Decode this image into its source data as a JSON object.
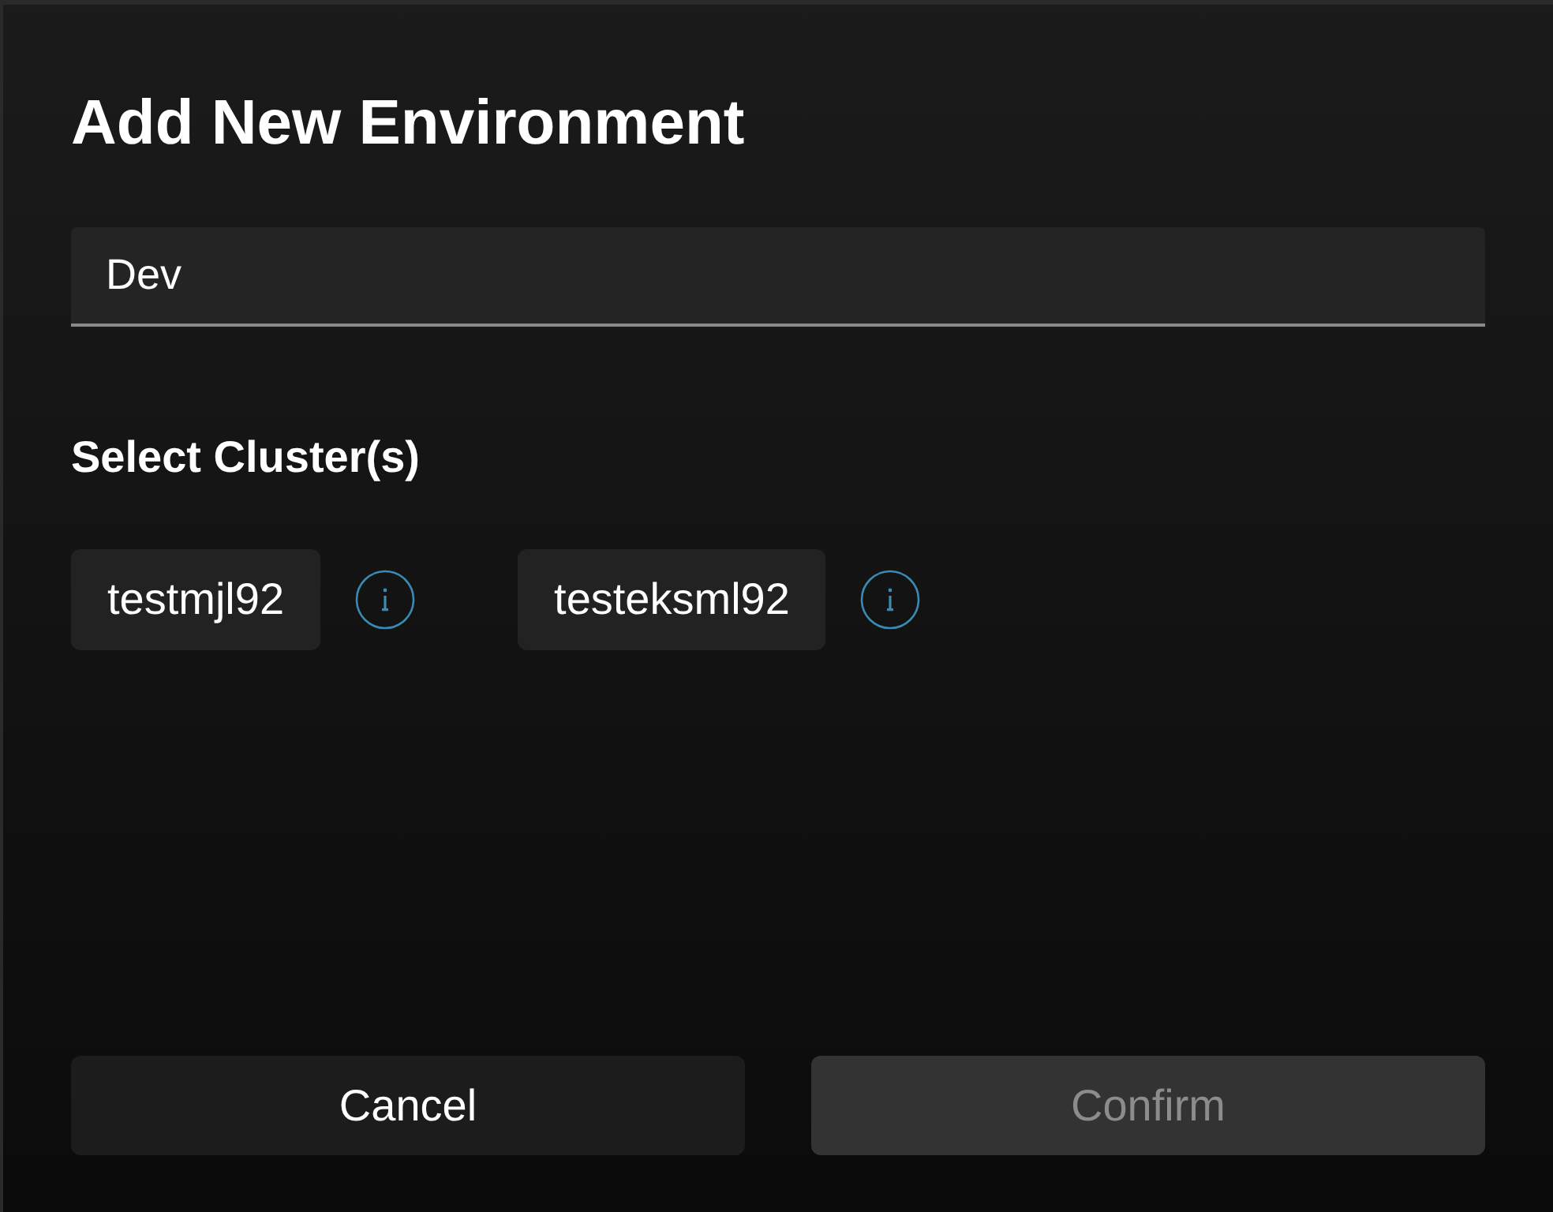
{
  "dialog": {
    "title": "Add New Environment"
  },
  "name_field": {
    "value": "Dev"
  },
  "clusters_label": "Select Cluster(s)",
  "clusters": [
    {
      "name": "testmjl92",
      "selected": false
    },
    {
      "name": "testeksml92",
      "selected": false
    }
  ],
  "buttons": [
    {
      "label": "Cancel",
      "kind": "secondary",
      "disabled": false
    },
    {
      "label": "Confirm",
      "kind": "primary",
      "disabled": true
    }
  ]
}
